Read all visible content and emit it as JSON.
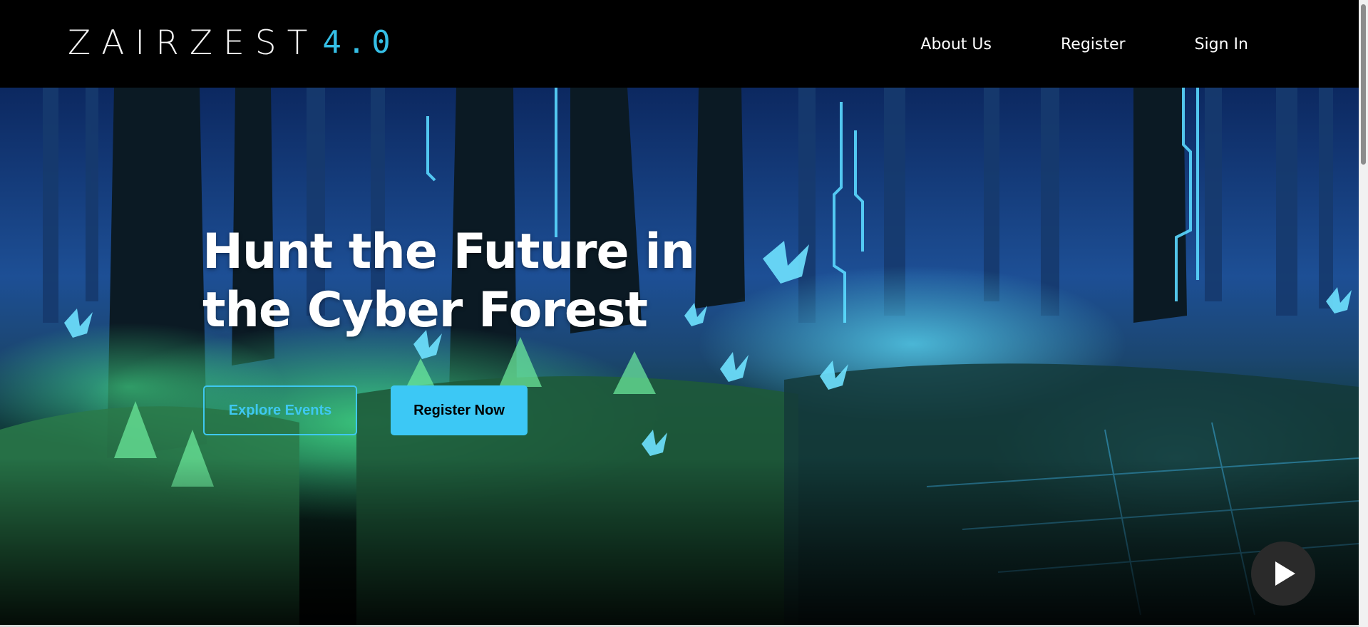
{
  "brand": {
    "logo_text": "ZAIRZEST",
    "logo_version": "4.0"
  },
  "nav": {
    "items": [
      {
        "label": "About Us"
      },
      {
        "label": "Register"
      },
      {
        "label": "Sign In"
      }
    ]
  },
  "hero": {
    "title": "Hunt the Future in the Cyber Forest",
    "buttons": {
      "explore_label": "Explore Events",
      "register_label": "Register Now"
    },
    "play_icon": "play-icon"
  },
  "colors": {
    "accent": "#3cc8f5",
    "header_bg": "#000000",
    "text": "#ffffff"
  }
}
